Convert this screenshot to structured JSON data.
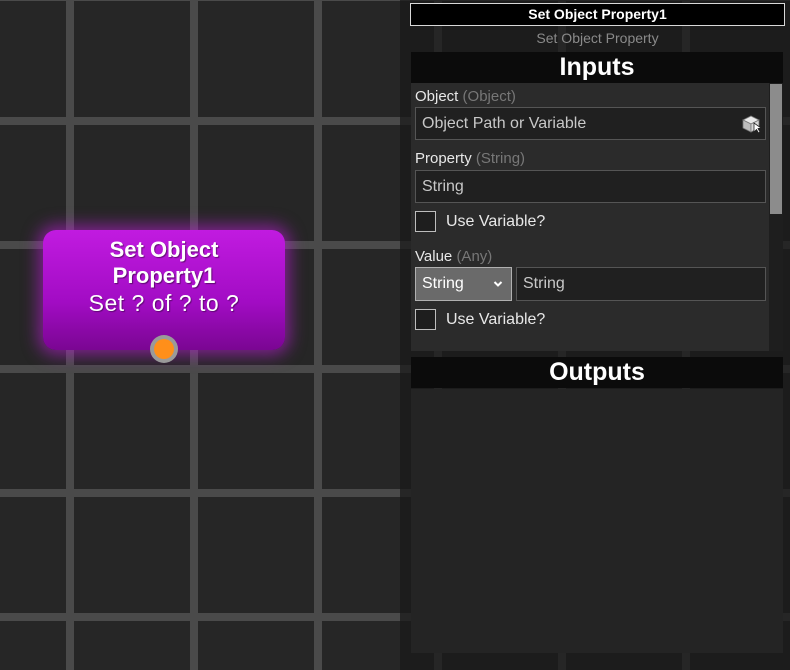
{
  "node": {
    "title": "Set Object Property1",
    "subtitle": "Set ? of ? to ?"
  },
  "panel": {
    "title": "Set Object Property1",
    "subtitle": "Set Object Property",
    "inputs_heading": "Inputs",
    "outputs_heading": "Outputs",
    "fields": {
      "object": {
        "label": "Object",
        "type": "(Object)",
        "placeholder": "Object Path or Variable",
        "picker_icon": "cube-icon"
      },
      "property": {
        "label": "Property",
        "type": "(String)",
        "placeholder": "String",
        "use_variable_label": "Use Variable?",
        "use_variable_checked": false
      },
      "value": {
        "label": "Value",
        "type": "(Any)",
        "type_selected": "String",
        "placeholder": "String",
        "use_variable_label": "Use Variable?",
        "use_variable_checked": false
      }
    }
  },
  "colors": {
    "node_fill": "#b313d4",
    "port": "#ff8f1a",
    "canvas": "#262626",
    "grid": "#4a4a4a"
  }
}
